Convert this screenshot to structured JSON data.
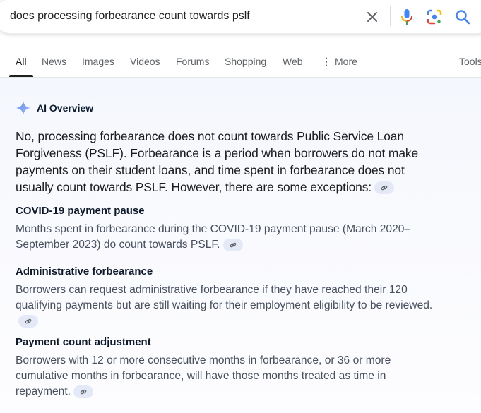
{
  "search": {
    "query": "does processing forbearance count towards pslf",
    "icons": [
      "clear-icon",
      "microphone-icon",
      "google-lens-icon",
      "search-icon"
    ]
  },
  "tabs": [
    {
      "label": "All",
      "active": true
    },
    {
      "label": "News"
    },
    {
      "label": "Images"
    },
    {
      "label": "Videos"
    },
    {
      "label": "Forums"
    },
    {
      "label": "Shopping"
    },
    {
      "label": "Web"
    },
    {
      "label": "More"
    },
    {
      "label": "Tools"
    }
  ],
  "ai_overview": {
    "title": "AI Overview",
    "lead": "No, processing forbearance does not count towards Public Service Loan Forgiveness (PSLF). Forbearance is a period when borrowers do not make payments on their student loans, and time spent in forbearance does not usually count towards PSLF. However, there are some exceptions:",
    "sections": [
      {
        "title": "COVID-19 payment pause",
        "body": "Months spent in forbearance during the COVID-19 payment pause (March 2020–September 2023) do count towards PSLF."
      },
      {
        "title": "Administrative forbearance",
        "body": "Borrowers can request administrative forbearance if they have reached their 120 qualifying payments but are still waiting for their employment eligibility to be reviewed."
      },
      {
        "title": "Payment count adjustment",
        "body": "Borrowers with 12 or more consecutive months in forbearance, or 36 or more cumulative months in forbearance, will have those months treated as time in repayment."
      }
    ]
  },
  "colors": {
    "accent_blue": "#4285f4",
    "cite_bg": "#e4e9f7",
    "active_tab": "#1f1f1f"
  }
}
